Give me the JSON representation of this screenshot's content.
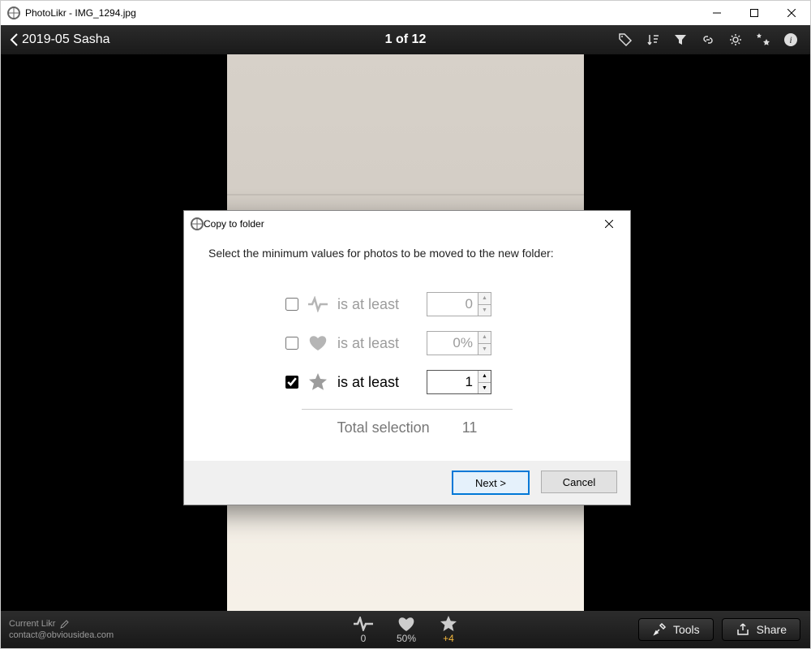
{
  "window": {
    "title": "PhotoLikr - IMG_1294.jpg"
  },
  "toolbar": {
    "back_label": "2019-05 Sasha",
    "counter": "1 of 12"
  },
  "dialog": {
    "title": "Copy to folder",
    "instruction": "Select the minimum values for photos to be moved to the new folder:",
    "criteria": [
      {
        "checked": false,
        "icon": "pulse",
        "label": "is at least",
        "value": "0"
      },
      {
        "checked": false,
        "icon": "heart",
        "label": "is at least",
        "value": "0%"
      },
      {
        "checked": true,
        "icon": "star",
        "label": "is at least",
        "value": "1"
      }
    ],
    "total_label": "Total selection",
    "total_value": "11",
    "next_label": "Next >",
    "cancel_label": "Cancel"
  },
  "bottom": {
    "current_likr_label": "Current Likr",
    "contact": "contact@obviousidea.com",
    "metrics": {
      "pulse": "0",
      "heart": "50%",
      "star": "+4"
    },
    "tools_label": "Tools",
    "share_label": "Share"
  }
}
